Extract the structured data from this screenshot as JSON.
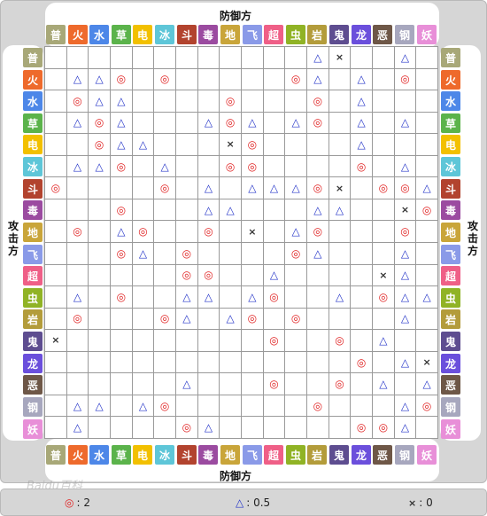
{
  "titles": {
    "defender": "防御方",
    "attacker": "攻击方"
  },
  "types": [
    {
      "name": "普",
      "color": "#a8a878"
    },
    {
      "name": "火",
      "color": "#ee6a2c"
    },
    {
      "name": "水",
      "color": "#4d87e8"
    },
    {
      "name": "草",
      "color": "#5bb34b"
    },
    {
      "name": "电",
      "color": "#f2c000"
    },
    {
      "name": "冰",
      "color": "#5ec6d8"
    },
    {
      "name": "斗",
      "color": "#b2432e"
    },
    {
      "name": "毒",
      "color": "#9b4ba0"
    },
    {
      "name": "地",
      "color": "#c9a53a"
    },
    {
      "name": "飞",
      "color": "#8a9ae8"
    },
    {
      "name": "超",
      "color": "#ef5f87"
    },
    {
      "name": "虫",
      "color": "#90b325"
    },
    {
      "name": "岩",
      "color": "#b39c3b"
    },
    {
      "name": "鬼",
      "color": "#5e4d90"
    },
    {
      "name": "龙",
      "color": "#6b4fdc"
    },
    {
      "name": "恶",
      "color": "#6e5747"
    },
    {
      "name": "钢",
      "color": "#a7a7be"
    },
    {
      "name": "妖",
      "color": "#e88fd8"
    }
  ],
  "matrix": [
    [
      "",
      "",
      "",
      "",
      "",
      "",
      "",
      "",
      "",
      "",
      "",
      "",
      "△",
      "×",
      "",
      "",
      "△",
      ""
    ],
    [
      "",
      "△",
      "△",
      "◎",
      "",
      "◎",
      "",
      "",
      "",
      "",
      "",
      "◎",
      "△",
      "",
      "△",
      "",
      "◎",
      ""
    ],
    [
      "",
      "◎",
      "△",
      "△",
      "",
      "",
      "",
      "",
      "◎",
      "",
      "",
      "",
      "◎",
      "",
      "△",
      "",
      "",
      ""
    ],
    [
      "",
      "△",
      "◎",
      "△",
      "",
      "",
      "",
      "△",
      "◎",
      "△",
      "",
      "△",
      "◎",
      "",
      "△",
      "",
      "△",
      ""
    ],
    [
      "",
      "",
      "◎",
      "△",
      "△",
      "",
      "",
      "",
      "×",
      "◎",
      "",
      "",
      "",
      "",
      "△",
      "",
      "",
      ""
    ],
    [
      "",
      "△",
      "△",
      "◎",
      "",
      "△",
      "",
      "",
      "◎",
      "◎",
      "",
      "",
      "",
      "",
      "◎",
      "",
      "△",
      ""
    ],
    [
      "◎",
      "",
      "",
      "",
      "",
      "◎",
      "",
      "△",
      "",
      "△",
      "△",
      "△",
      "◎",
      "×",
      "",
      "◎",
      "◎",
      "△"
    ],
    [
      "",
      "",
      "",
      "◎",
      "",
      "",
      "",
      "△",
      "△",
      "",
      "",
      "",
      "△",
      "△",
      "",
      "",
      "×",
      "◎"
    ],
    [
      "",
      "◎",
      "",
      "△",
      "◎",
      "",
      "",
      "◎",
      "",
      "×",
      "",
      "△",
      "◎",
      "",
      "",
      "",
      "◎",
      ""
    ],
    [
      "",
      "",
      "",
      "◎",
      "△",
      "",
      "◎",
      "",
      "",
      "",
      "",
      "◎",
      "△",
      "",
      "",
      "",
      "△",
      ""
    ],
    [
      "",
      "",
      "",
      "",
      "",
      "",
      "◎",
      "◎",
      "",
      "",
      "△",
      "",
      "",
      "",
      "",
      "×",
      "△",
      ""
    ],
    [
      "",
      "△",
      "",
      "◎",
      "",
      "",
      "△",
      "△",
      "",
      "△",
      "◎",
      "",
      "",
      "△",
      "",
      "◎",
      "△",
      "△"
    ],
    [
      "",
      "◎",
      "",
      "",
      "",
      "◎",
      "△",
      "",
      "△",
      "◎",
      "",
      "◎",
      "",
      "",
      "",
      "",
      "△",
      ""
    ],
    [
      "×",
      "",
      "",
      "",
      "",
      "",
      "",
      "",
      "",
      "",
      "◎",
      "",
      "",
      "◎",
      "",
      "△",
      "",
      ""
    ],
    [
      "",
      "",
      "",
      "",
      "",
      "",
      "",
      "",
      "",
      "",
      "",
      "",
      "",
      "",
      "◎",
      "",
      "△",
      "×"
    ],
    [
      "",
      "",
      "",
      "",
      "",
      "",
      "△",
      "",
      "",
      "",
      "◎",
      "",
      "",
      "◎",
      "",
      "△",
      "",
      "△"
    ],
    [
      "",
      "△",
      "△",
      "",
      "△",
      "◎",
      "",
      "",
      "",
      "",
      "",
      "",
      "◎",
      "",
      "",
      "",
      "△",
      "◎"
    ],
    [
      "",
      "△",
      "",
      "",
      "",
      "",
      "◎",
      "△",
      "",
      "",
      "",
      "",
      "",
      "",
      "◎",
      "◎",
      "△",
      ""
    ]
  ],
  "legend": [
    {
      "symbol": "◎",
      "label": ": 2"
    },
    {
      "symbol": "△",
      "label": ": 0.5"
    },
    {
      "symbol": "×",
      "label": ": 0"
    }
  ],
  "watermark": "Baidu百科"
}
